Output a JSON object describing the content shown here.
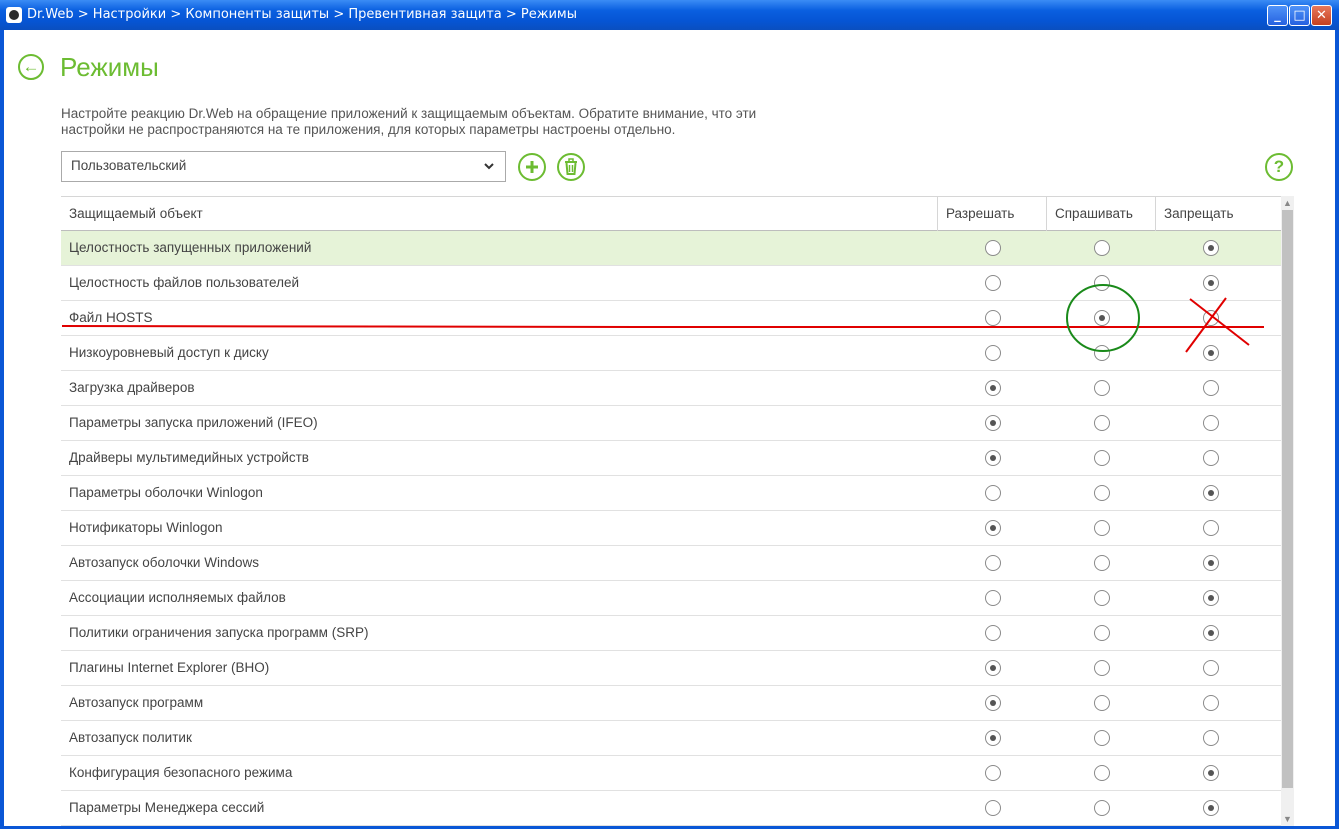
{
  "window": {
    "title": "Dr.Web > Настройки > Компоненты защиты > Превентивная защита > Режимы",
    "minimize_glyph": "_",
    "maximize_glyph": "□",
    "close_glyph": "✕"
  },
  "page": {
    "title": "Режимы",
    "description": "Настройте реакцию Dr.Web на обращение приложений к защищаемым объектам. Обратите внимание, что эти настройки не распространяются на те приложения, для которых параметры настроены отдельно.",
    "back_glyph": "←",
    "help_glyph": "?"
  },
  "profile": {
    "selected": "Пользовательский"
  },
  "table": {
    "columns": [
      "Защищаемый объект",
      "Разрешать",
      "Спрашивать",
      "Запрещать"
    ],
    "rows": [
      {
        "name": "Целостность запущенных приложений",
        "mode": 2,
        "selected": true
      },
      {
        "name": "Целостность файлов пользователей",
        "mode": 2
      },
      {
        "name": "Файл HOSTS",
        "mode": 1
      },
      {
        "name": "Низкоуровневый доступ к диску",
        "mode": 2
      },
      {
        "name": "Загрузка драйверов",
        "mode": 0
      },
      {
        "name": "Параметры запуска приложений (IFEO)",
        "mode": 0
      },
      {
        "name": "Драйверы мультимедийных устройств",
        "mode": 0
      },
      {
        "name": "Параметры оболочки Winlogon",
        "mode": 2
      },
      {
        "name": "Нотификаторы Winlogon",
        "mode": 0
      },
      {
        "name": "Автозапуск оболочки Windows",
        "mode": 2
      },
      {
        "name": "Ассоциации исполняемых файлов",
        "mode": 2
      },
      {
        "name": "Политики ограничения запуска программ (SRP)",
        "mode": 2
      },
      {
        "name": "Плагины Internet Explorer (BHO)",
        "mode": 0
      },
      {
        "name": "Автозапуск программ",
        "mode": 0
      },
      {
        "name": "Автозапуск политик",
        "mode": 0
      },
      {
        "name": "Конфигурация безопасного режима",
        "mode": 2
      },
      {
        "name": "Параметры Менеджера сессий",
        "mode": 2
      }
    ]
  },
  "colors": {
    "accent": "#6cbc32",
    "selected_row": "#e6f3d8",
    "annotation_red": "#e00000",
    "annotation_green": "#1a8a1a"
  }
}
